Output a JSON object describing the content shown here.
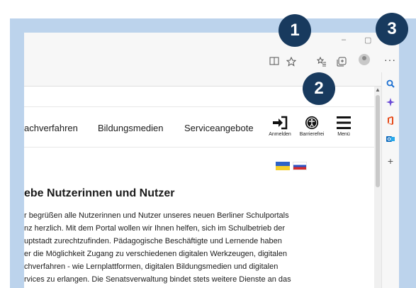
{
  "browser": {
    "window_controls": {
      "minimize": "–",
      "maximize": "▢"
    },
    "toolbar_icons": [
      "reader-view-icon",
      "add-favorite-icon",
      "favorites-icon",
      "collections-icon",
      "profile-icon",
      "more-icon"
    ],
    "more_label": "···",
    "sidebar_icons": [
      "search-icon",
      "copilot-icon",
      "office-icon",
      "outlook-icon",
      "add-icon"
    ]
  },
  "nav": {
    "links": [
      "achverfahren",
      "Bildungsmedien",
      "Serviceangebote"
    ],
    "actions": [
      {
        "label": "Anmelden",
        "icon": "login-icon"
      },
      {
        "label": "Barrierefrei",
        "icon": "accessibility-icon"
      },
      {
        "label": "Menü",
        "icon": "menu-icon"
      }
    ]
  },
  "flags": [
    "ukraine-flag",
    "russia-flag"
  ],
  "article": {
    "heading": "ebe Nutzerinnen und Nutzer",
    "lines": [
      "r begrüßen alle Nutzerinnen und Nutzer unseres neuen Berliner Schulportals",
      "nz herzlich. Mit dem Portal wollen wir Ihnen helfen, sich im Schulbetrieb der",
      "uptstadt zurechtzufinden. Pädagogische Beschäftigte und Lernende haben",
      "er die Möglichkeit Zugang zu verschiedenen digitalen Werkzeugen, digitalen",
      "chverfahren - wie Lernplattformen, digitalen Bildungsmedien und digitalen",
      "rvices zu erlangen. Die Senatsverwaltung bindet stets weitere Dienste an das"
    ]
  },
  "callouts": [
    "1",
    "2",
    "3"
  ],
  "colors": {
    "frame": "#bcd3ec",
    "callout": "#183a5e",
    "flag_ua_top": "#2d63c8",
    "flag_ua_bottom": "#f5cf2a",
    "flag_ru_blue": "#2b52c4",
    "flag_ru_red": "#d52b2b"
  }
}
